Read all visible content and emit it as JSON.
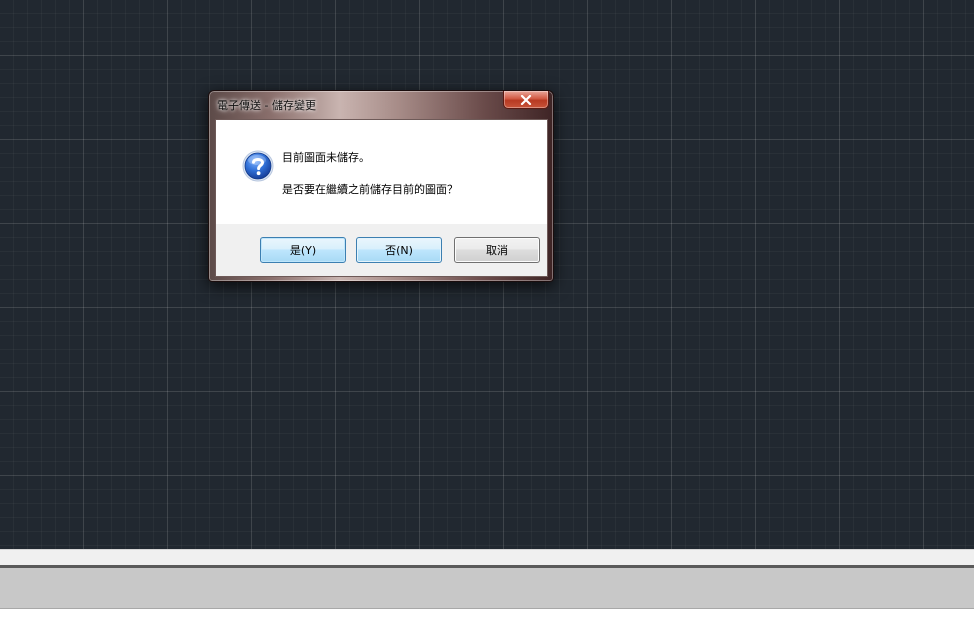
{
  "dialog": {
    "title": "電子傳送 - 儲存變更",
    "close_label": "x",
    "icon": "question-icon",
    "message_line1": "目前圖面未儲存。",
    "message_line2": "是否要在繼續之前儲存目前的圖面？",
    "buttons": {
      "yes_label": "是(Y)",
      "no_label": "否(N)",
      "cancel_label": "取消"
    }
  },
  "colors": {
    "canvas_background": "#212830",
    "button_accent": "#3c7fb1",
    "close_button": "#c8543a",
    "question_icon": "#1f57b0"
  }
}
